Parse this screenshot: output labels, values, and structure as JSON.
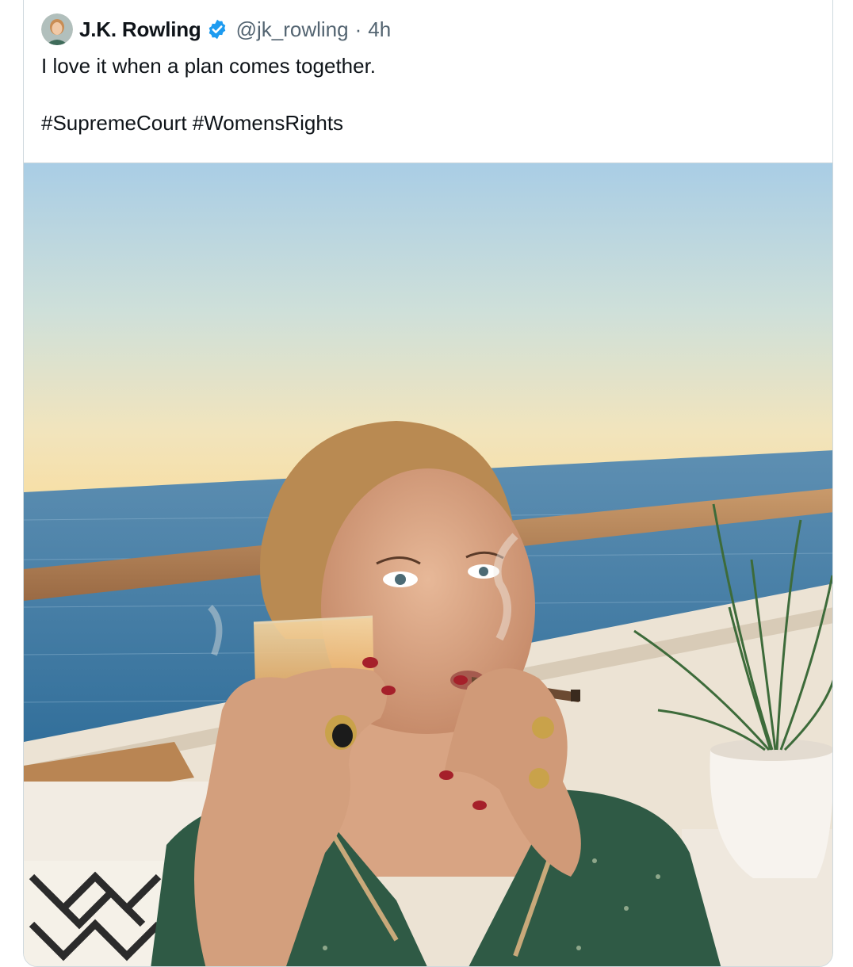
{
  "tweet": {
    "author": {
      "display_name": "J.K. Rowling",
      "handle": "@jk_rowling",
      "verified": true
    },
    "separator": "·",
    "timestamp": "4h",
    "text_line_1": "I love it when a plan comes together.",
    "hashtags": [
      "#SupremeCourt",
      "#WomensRights"
    ]
  },
  "colors": {
    "verified_blue": "#1d9bf0",
    "secondary_text": "#536471",
    "card_border": "#cfd9de"
  }
}
